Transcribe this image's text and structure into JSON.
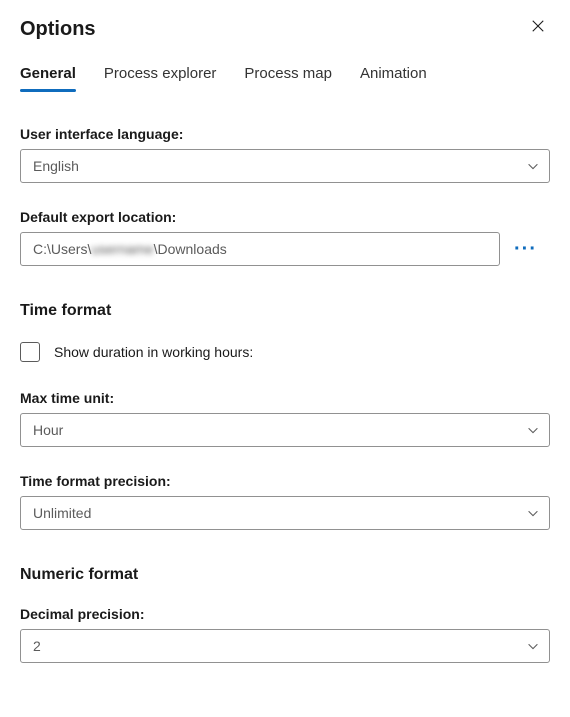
{
  "dialog": {
    "title": "Options"
  },
  "tabs": {
    "general": "General",
    "processExplorer": "Process explorer",
    "processMap": "Process map",
    "animation": "Animation"
  },
  "fields": {
    "languageLabel": "User interface language:",
    "languageValue": "English",
    "exportLabel": "Default export location:",
    "exportPrefix": "C:\\Users\\",
    "exportUser": "username",
    "exportSuffix": "\\Downloads"
  },
  "timeFormat": {
    "sectionTitle": "Time format",
    "showDurationLabel": "Show duration in working hours:",
    "maxTimeUnitLabel": "Max time unit:",
    "maxTimeUnitValue": "Hour",
    "precisionLabel": "Time format precision:",
    "precisionValue": "Unlimited"
  },
  "numericFormat": {
    "sectionTitle": "Numeric format",
    "decimalLabel": "Decimal precision:",
    "decimalValue": "2"
  }
}
